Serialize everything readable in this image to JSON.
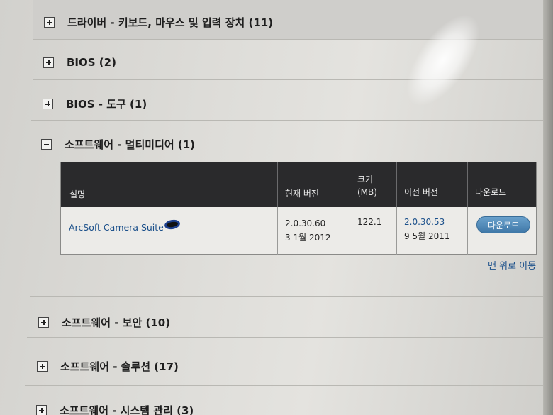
{
  "sections": [
    {
      "title": "드라이버 - 키보드, 마우스 및 입력 장치 (11)",
      "state": "collapsed"
    },
    {
      "title": "BIOS (2)",
      "state": "collapsed"
    },
    {
      "title": "BIOS - 도구 (1)",
      "state": "collapsed"
    },
    {
      "title": "소프트웨어 - 멀티미디어 (1)",
      "state": "expanded"
    },
    {
      "title": "소프트웨어 - 보안 (10)",
      "state": "collapsed"
    },
    {
      "title": "소프트웨어 - 솔루션 (17)",
      "state": "collapsed"
    },
    {
      "title": "소프트웨어 - 시스템 관리 (3)",
      "state": "collapsed"
    }
  ],
  "table": {
    "headers": {
      "description": "설명",
      "current_version": "현재 버전",
      "size_line1": "크기",
      "size_line2": "(MB)",
      "previous_version": "이전 버전",
      "download": "다운로드"
    },
    "rows": [
      {
        "name": "ArcSoft Camera Suite",
        "current_version": "2.0.30.60",
        "current_date": "3 1월 2012",
        "size": "122.1",
        "previous_version": "2.0.30.53",
        "previous_date": "9 5월 2011",
        "download_label": "다운로드"
      }
    ]
  },
  "back_to_top": "맨 위로 이동",
  "colors": {
    "header_bg": "#2a2a2c",
    "link": "#1a4f8a",
    "button": "#4f88b6"
  }
}
